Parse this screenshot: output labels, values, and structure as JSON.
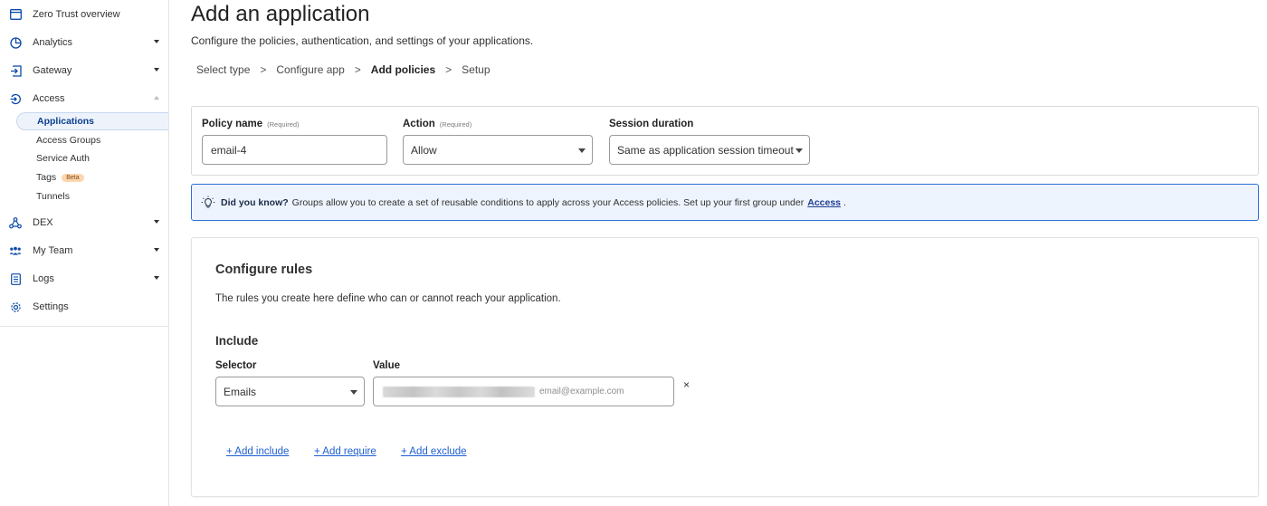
{
  "sidebar": {
    "items": [
      {
        "label": "Zero Trust overview",
        "icon": "browser-window-icon"
      },
      {
        "label": "Analytics",
        "icon": "pie-chart-icon"
      },
      {
        "label": "Gateway",
        "icon": "gateway-icon"
      },
      {
        "label": "Access",
        "icon": "access-icon"
      },
      {
        "label": "DEX",
        "icon": "network-icon"
      },
      {
        "label": "My Team",
        "icon": "team-icon"
      },
      {
        "label": "Logs",
        "icon": "document-icon"
      },
      {
        "label": "Settings",
        "icon": "gear-icon"
      }
    ],
    "access_subitems": [
      {
        "label": "Applications",
        "active": true
      },
      {
        "label": "Access Groups"
      },
      {
        "label": "Service Auth"
      },
      {
        "label": "Tags",
        "badge": "Beta"
      },
      {
        "label": "Tunnels"
      }
    ]
  },
  "header": {
    "title": "Add an application",
    "description": "Configure the policies, authentication, and settings of your applications."
  },
  "breadcrumb": {
    "steps": [
      "Select type",
      "Configure app",
      "Add policies",
      "Setup"
    ],
    "separator": ">",
    "current": "Add policies"
  },
  "policy": {
    "name_label": "Policy name",
    "name_required": "(Required)",
    "name_value": "email-4",
    "action_label": "Action",
    "action_required": "(Required)",
    "action_value": "Allow",
    "session_label": "Session duration",
    "session_value": "Same as application session timeout"
  },
  "banner": {
    "heading": "Did you know?",
    "text": "Groups allow you to create a set of reusable conditions to apply across your Access policies. Set up your first group under",
    "link": "Access",
    "trailing": "."
  },
  "rules": {
    "title": "Configure rules",
    "description": "The rules you create here define who can or cannot reach your application.",
    "include_title": "Include",
    "selector_label": "Selector",
    "selector_value": "Emails",
    "value_label": "Value",
    "value_placeholder": "email@example.com",
    "remove_label": "×",
    "add_include": "+ Add include",
    "add_require": "+ Add require",
    "add_exclude": "+ Add exclude"
  },
  "colors": {
    "accent": "#1e5fd1",
    "banner_border": "#2c6fd6",
    "banner_bg": "#eef4fd",
    "active_nav_bg": "#eef3fb"
  }
}
